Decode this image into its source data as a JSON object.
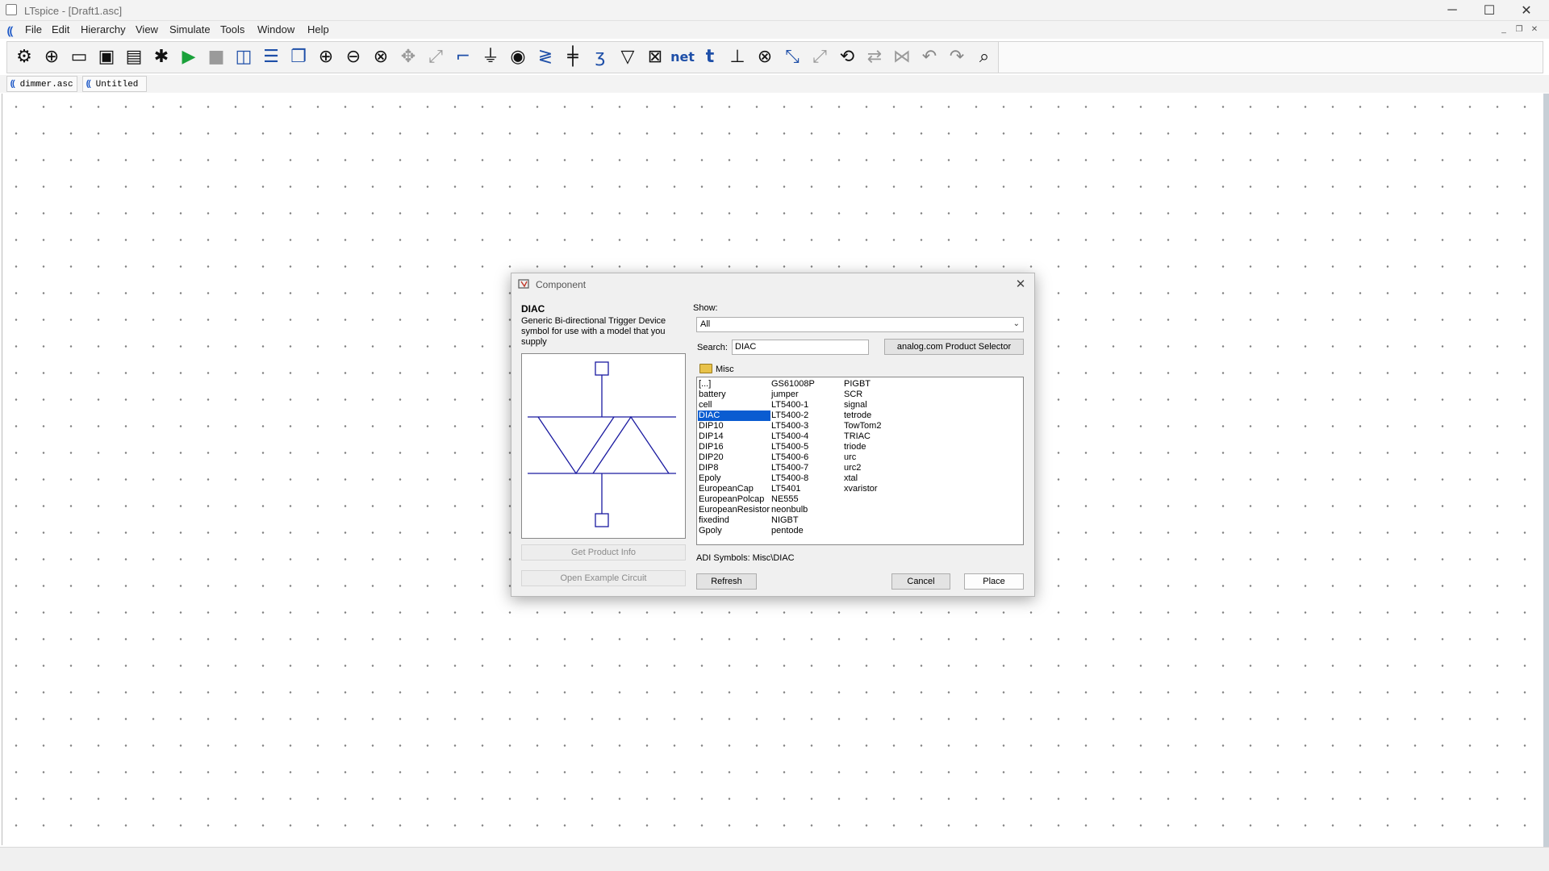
{
  "window": {
    "title": "LTspice - [Draft1.asc]"
  },
  "menu": [
    "File",
    "Edit",
    "Hierarchy",
    "View",
    "Simulate",
    "Tools",
    "Window",
    "Help"
  ],
  "toolbar": {
    "icons": [
      "settings-icon",
      "new-schematic-icon",
      "open-icon",
      "save-icon",
      "print-icon",
      "control-panel-icon",
      "run-icon",
      "halt-icon",
      "tile-vertical-icon",
      "tile-horizontal-icon",
      "cascade-icon",
      "zoom-in-icon",
      "zoom-out-icon",
      "zoom-fit-icon",
      "pan-icon",
      "autorange-icon",
      "wire-icon",
      "ground-icon",
      "label-net-icon",
      "resistor-icon",
      "capacitor-icon",
      "inductor-icon",
      "diode-icon",
      "component-icon",
      "net-label-icon",
      "text-icon",
      "spice-directive-icon",
      "delete-icon",
      "move-icon",
      "drag-icon",
      "rotate-icon",
      "mirror-icon",
      "draw-line-icon",
      "undo-icon",
      "redo-icon",
      "find-icon"
    ],
    "net_label": "net",
    "text_label": "t"
  },
  "tabs": [
    {
      "label": "dimmer.asc"
    },
    {
      "label": "Untitled"
    }
  ],
  "dialog": {
    "title": "Component",
    "component_name": "DIAC",
    "description": "Generic Bi-directional Trigger Device symbol for use with a model that you supply",
    "show_label": "Show:",
    "show_value": "All",
    "search_label": "Search:",
    "search_value": "DIAC",
    "product_selector_button": "analog.com Product Selector",
    "folder": "Misc",
    "columns": [
      [
        "[...]",
        "battery",
        "cell",
        "DIAC",
        "DIP10",
        "DIP14",
        "DIP16",
        "DIP20",
        "DIP8",
        "Epoly",
        "EuropeanCap",
        "EuropeanPolcap",
        "EuropeanResistor",
        "fixedind",
        "Gpoly"
      ],
      [
        "GS61008P",
        "jumper",
        "LT5400-1",
        "LT5400-2",
        "LT5400-3",
        "LT5400-4",
        "LT5400-5",
        "LT5400-6",
        "LT5400-7",
        "LT5400-8",
        "LT5401",
        "NE555",
        "neonbulb",
        "NIGBT",
        "pentode"
      ],
      [
        "PIGBT",
        "SCR",
        "signal",
        "tetrode",
        "TowTom2",
        "TRIAC",
        "triode",
        "urc",
        "urc2",
        "xtal",
        "xvaristor"
      ]
    ],
    "selected_item": "DIAC",
    "adi_path": "ADI Symbols: Misc\\DIAC",
    "get_product_info_button": "Get Product Info",
    "open_example_button": "Open Example Circuit",
    "refresh_button": "Refresh",
    "cancel_button": "Cancel",
    "place_button": "Place"
  },
  "colors": {
    "accent": "#0a5cd1",
    "symbol_blue": "#1a1aa0",
    "logo_blue": "#1a56c6"
  }
}
